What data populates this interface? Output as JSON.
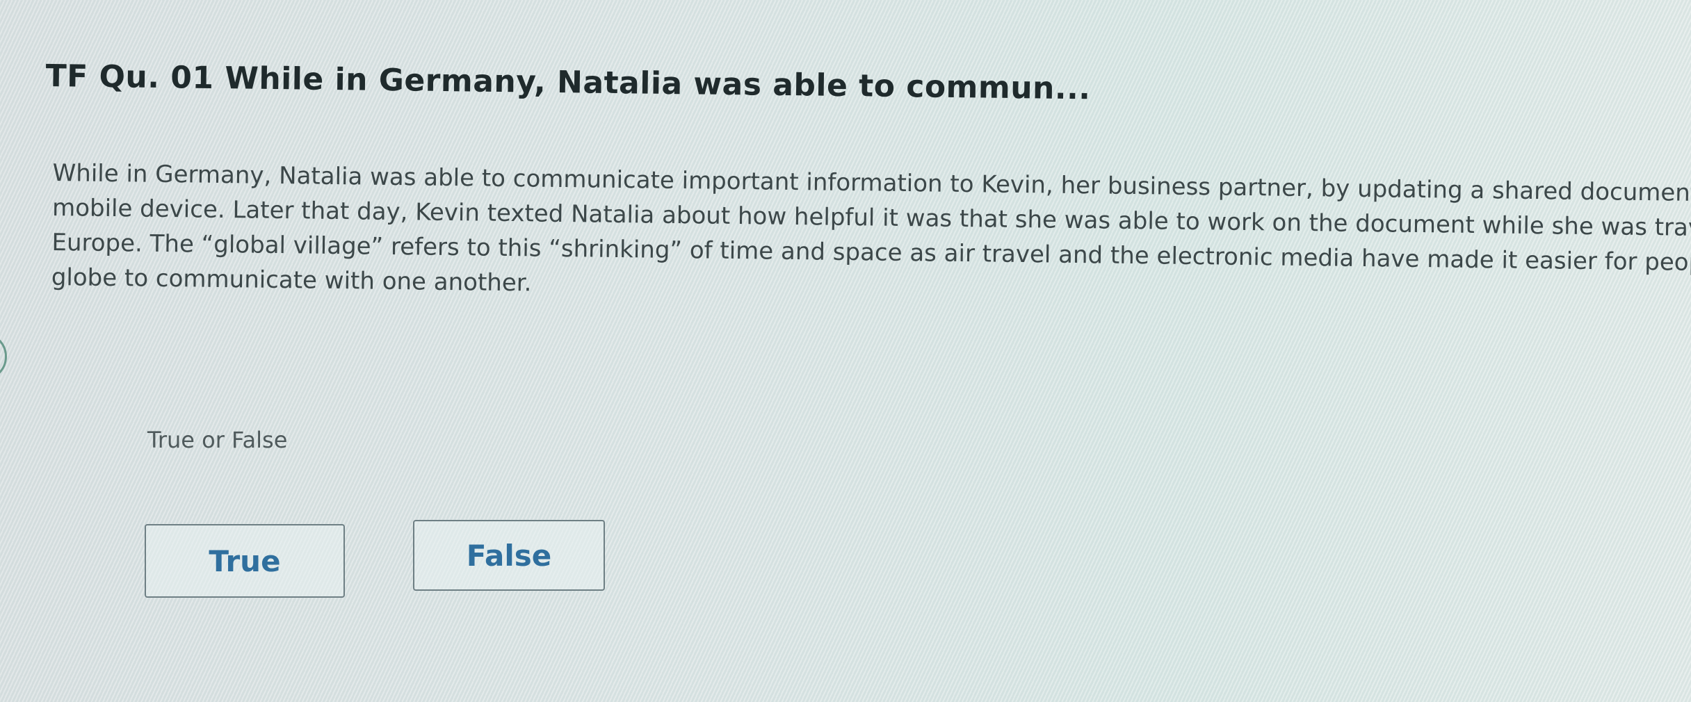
{
  "question": {
    "title": "TF Qu. 01 While in Germany, Natalia was able to commun...",
    "body_lines": [
      "While in Germany, Natalia was able to communicate important information to Kevin, her business partner, by updating a shared document",
      "mobile device. Later that day, Kevin texted Natalia about how helpful it was that she was able to work on the document while she was trav",
      "Europe. The “global village” refers to this “shrinking” of time and space as air travel and the electronic media have made it easier for peopl",
      "globe to communicate with one another."
    ]
  },
  "answer": {
    "prompt": "True or False",
    "options": [
      {
        "label": "True"
      },
      {
        "label": "False"
      }
    ],
    "accent_color": "#2f6f9e"
  }
}
